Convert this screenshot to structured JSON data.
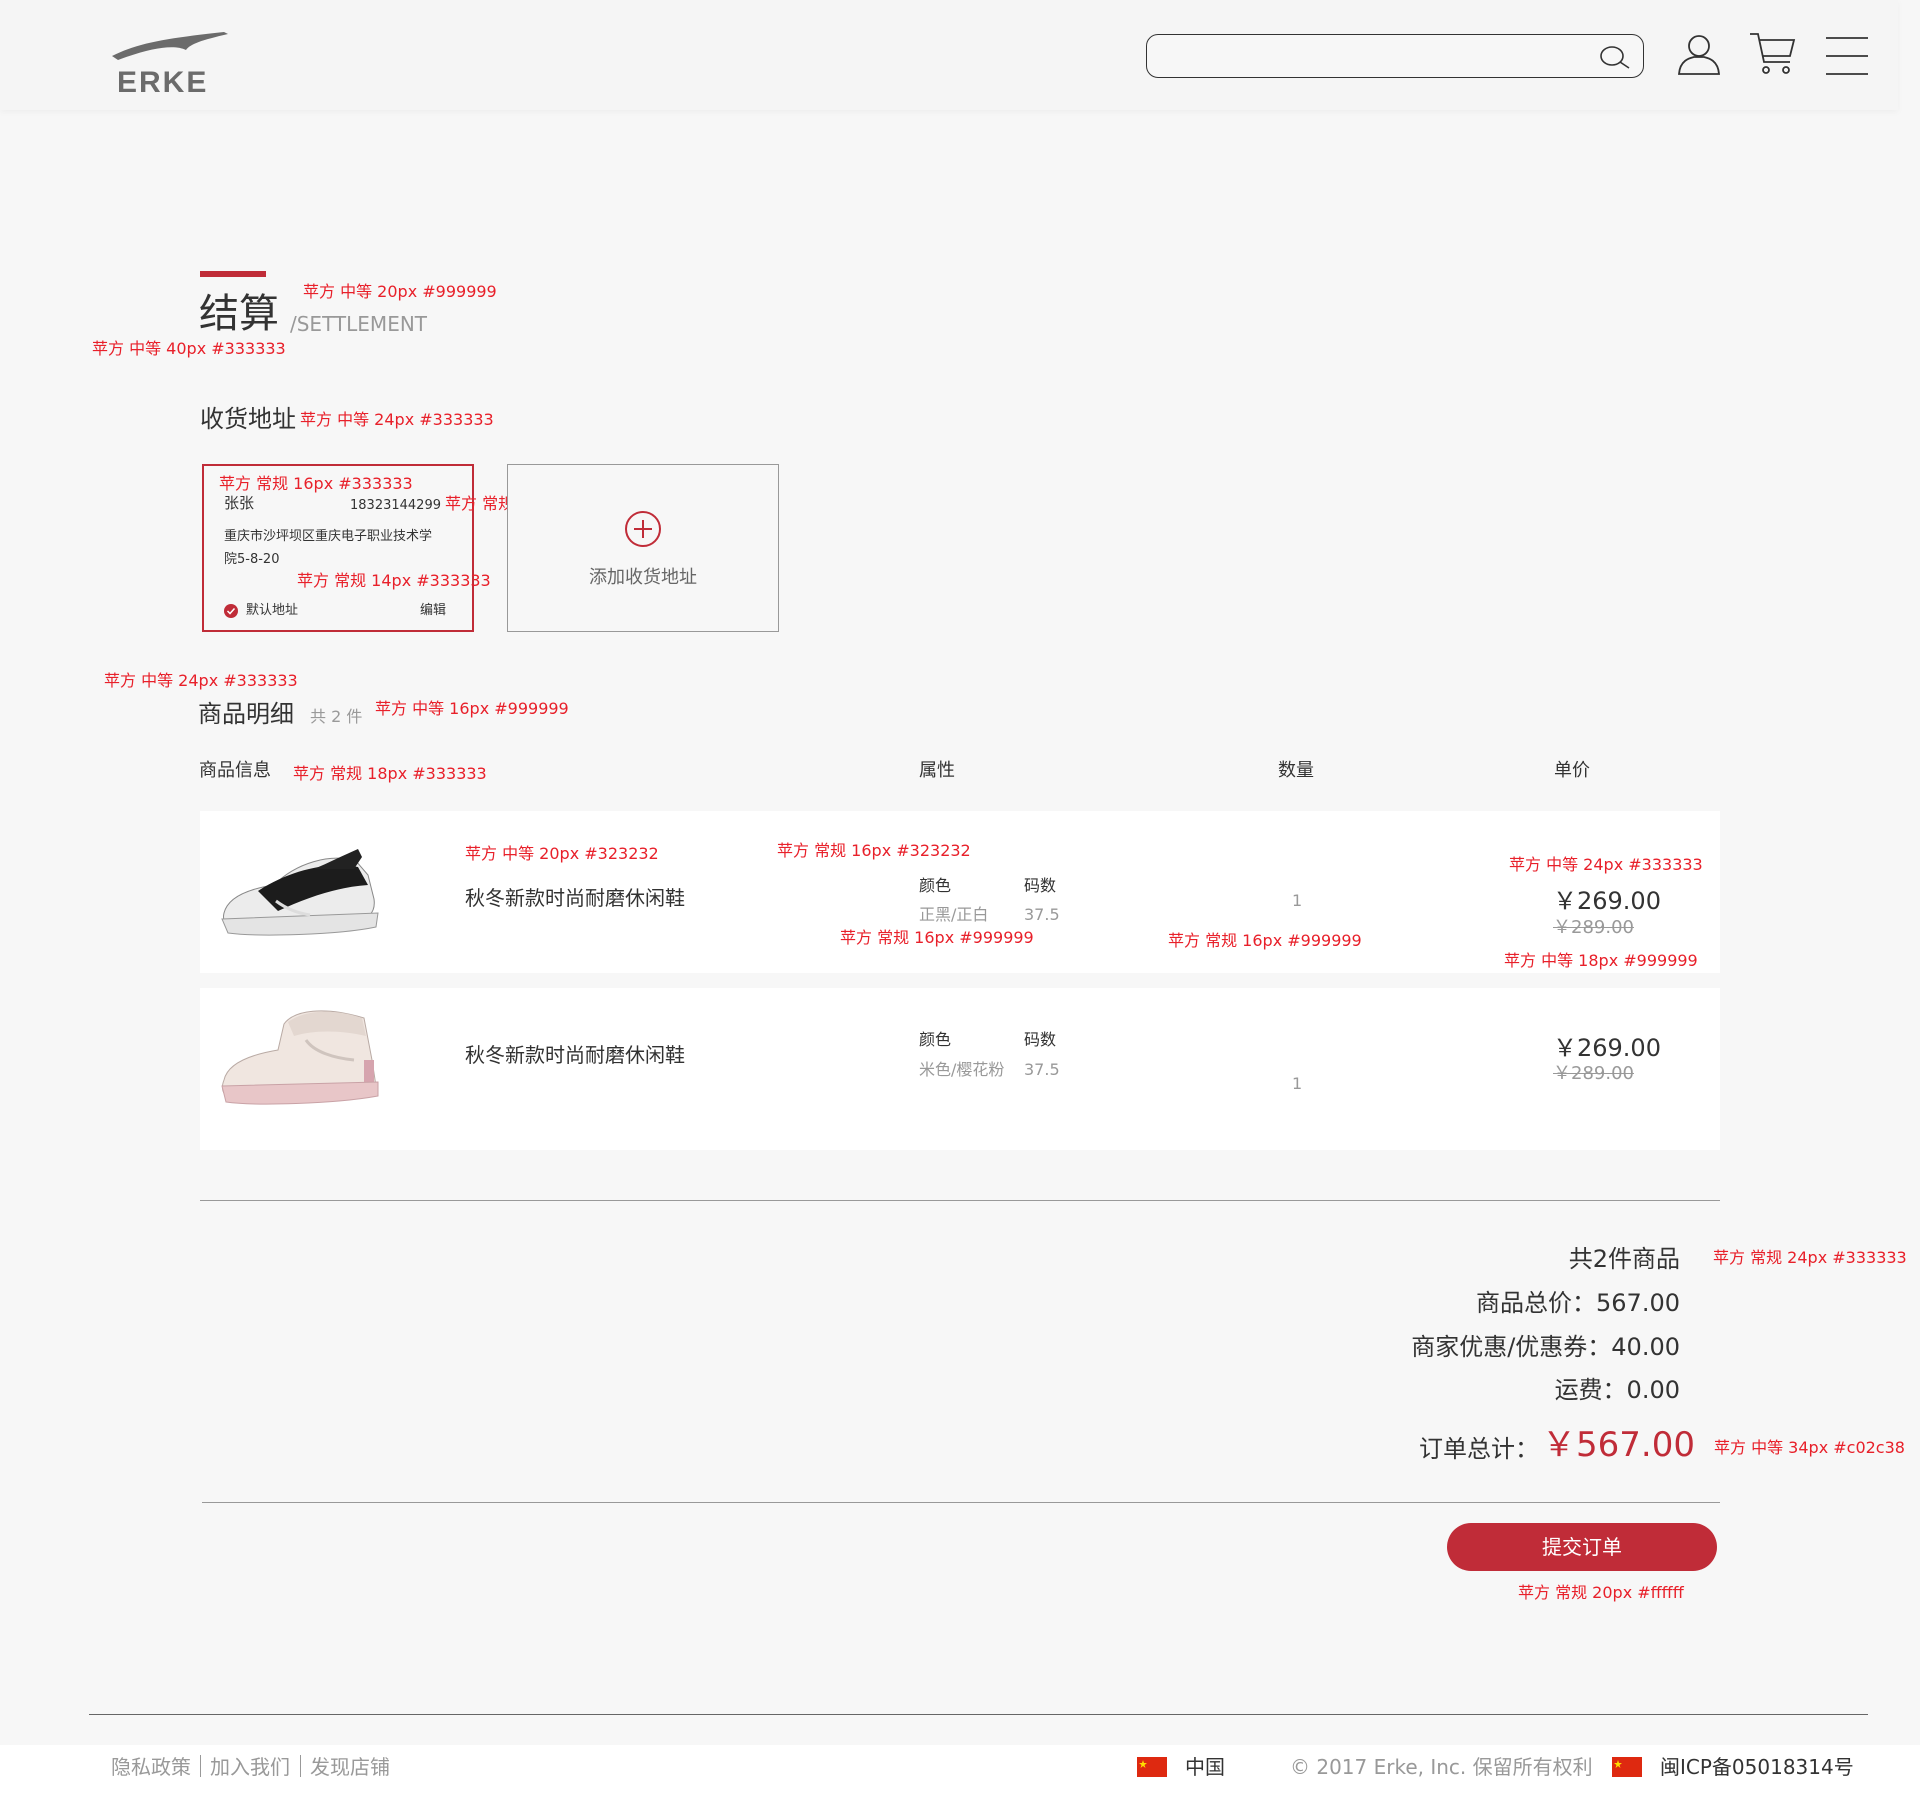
{
  "header": {
    "logo_text": "ERKE",
    "search_placeholder": "",
    "icons": [
      "search-icon",
      "user-icon",
      "cart-icon",
      "menu-icon"
    ]
  },
  "page": {
    "title": "结算",
    "subtitle": "/SETTLEMENT"
  },
  "address_section": {
    "title": "收货地址",
    "card": {
      "name": "张张",
      "phone": "18323144299",
      "address_line1": "重庆市沙坪坝区重庆电子职业技术学",
      "address_line2": "院5-8-20",
      "default_label": "默认地址",
      "edit_label": "编辑"
    },
    "add_label": "添加收货地址"
  },
  "goods_section": {
    "title": "商品明细",
    "count": "共 2 件",
    "columns": {
      "info": "商品信息",
      "attr": "属性",
      "qty": "数量",
      "price": "单价"
    },
    "items": [
      {
        "name": "秋冬新款时尚耐磨休闲鞋",
        "color_label": "颜色",
        "size_label": "码数",
        "color": "正黑/正白",
        "size": "37.5",
        "qty": "1",
        "price": "￥269.00",
        "old_price": "￥289.00"
      },
      {
        "name": "秋冬新款时尚耐磨休闲鞋",
        "color_label": "颜色",
        "size_label": "码数",
        "color": "米色/樱花粉",
        "size": "37.5",
        "qty": "1",
        "price": "￥269.00",
        "old_price": "￥289.00"
      }
    ]
  },
  "summary": {
    "count": "共2件商品",
    "subtotal": "商品总价：567.00",
    "discount": "商家优惠/优惠券：40.00",
    "shipping": "运费：0.00",
    "total_label": "订单总计：",
    "total_value": "￥567.00",
    "submit_label": "提交订单"
  },
  "annotations": {
    "a1": "苹方 中等 20px #999999",
    "a2": "苹方 中等 40px #333333",
    "a3": "苹方 中等 24px #333333",
    "a4": "苹方 常规 16px #333333",
    "a5": "苹方 常规 14px #333333",
    "a6": "苹方 常规 14px #333333",
    "a7": "苹方 中等 24px #333333",
    "a8": "苹方 中等 16px #999999",
    "a9": "苹方 常规 18px #333333",
    "a10": "苹方 中等 20px #323232",
    "a11": "苹方 常规 16px #323232",
    "a12": "苹方 中等 24px #333333",
    "a13": "苹方 常规 16px #999999",
    "a14": "苹方 常规 16px #999999",
    "a15": "苹方 中等 18px #999999",
    "a16": "苹方 常规 24px #333333",
    "a17": "苹方 中等 34px #c02c38",
    "a18": "苹方 常规 20px #ffffff"
  },
  "footer": {
    "links": [
      "隐私政策",
      "加入我们",
      "发现店铺"
    ],
    "region": "中国",
    "copyright": "© 2017 Erke, Inc. 保留所有权利",
    "icp": "闽ICP备05018314号"
  },
  "colors": {
    "accent": "#c02c38",
    "background": "#f7f7f7",
    "text": "#333333",
    "muted": "#999999"
  }
}
